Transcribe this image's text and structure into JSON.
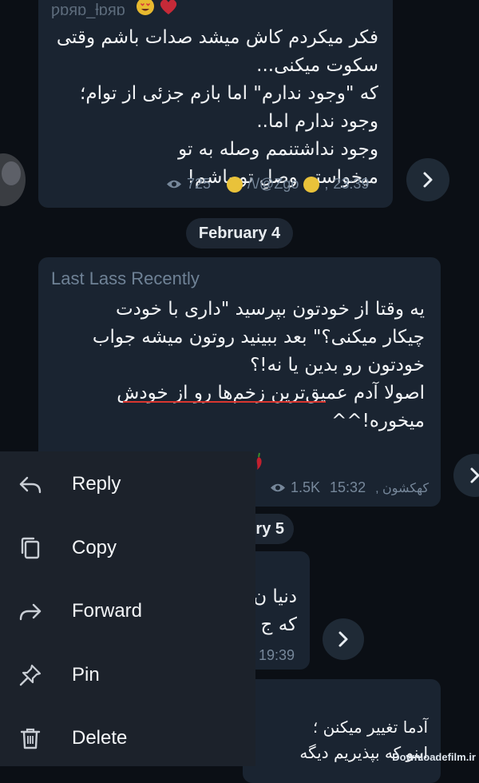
{
  "messages": [
    {
      "author": "ƿɒяɒ_ƚɒяɒ",
      "text": "فکر میکردم کاش میشد صدات باشم وقتی\nسکوت میکنی...\nکه \"وجود ندارم\" اما بازم جزئی از توام؛\nوجود ندارم اما..\nوجود نداشتنمم وصله به تو\nمیخواستم وصلِ تو باشم!",
      "views": "725",
      "signature": "/\\/@Zgo",
      "time": "23:39"
    },
    {
      "author": "Last Lass Recently",
      "text": "یه وقتا از خودتون بپرسید \"داری با خودت\nچیکار میکنی؟\" بعد ببینید روتون میشه جواب\nخودتون رو بدین یا نه!؟\nاصولا آدم عمیق‌ترین زخم‌ها رو از خودش\nمیخوره!^^",
      "views": "1.5K",
      "time": "15:32",
      "signature": "کهکشون ,"
    },
    {
      "text_fragment": "دنیا ن\nکه ج",
      "time": "19:39"
    },
    {
      "text": "آدما تغییر میکنن ؛\nاینو که بپذیریم دیگه"
    }
  ],
  "dates": {
    "first": "February 4",
    "second_partial": "ry 5"
  },
  "context_menu": {
    "items": [
      {
        "label": "Reply",
        "icon": "reply-icon"
      },
      {
        "label": "Copy",
        "icon": "copy-icon"
      },
      {
        "label": "Forward",
        "icon": "forward-icon"
      },
      {
        "label": "Pin",
        "icon": "pin-icon"
      },
      {
        "label": "Delete",
        "icon": "delete-icon"
      }
    ]
  },
  "watermark": "Downloadefilm.ir",
  "colors": {
    "background": "#0b0f15",
    "bubble": "#1a2431",
    "menu": "#1c222b",
    "underline": "#d9362f"
  }
}
